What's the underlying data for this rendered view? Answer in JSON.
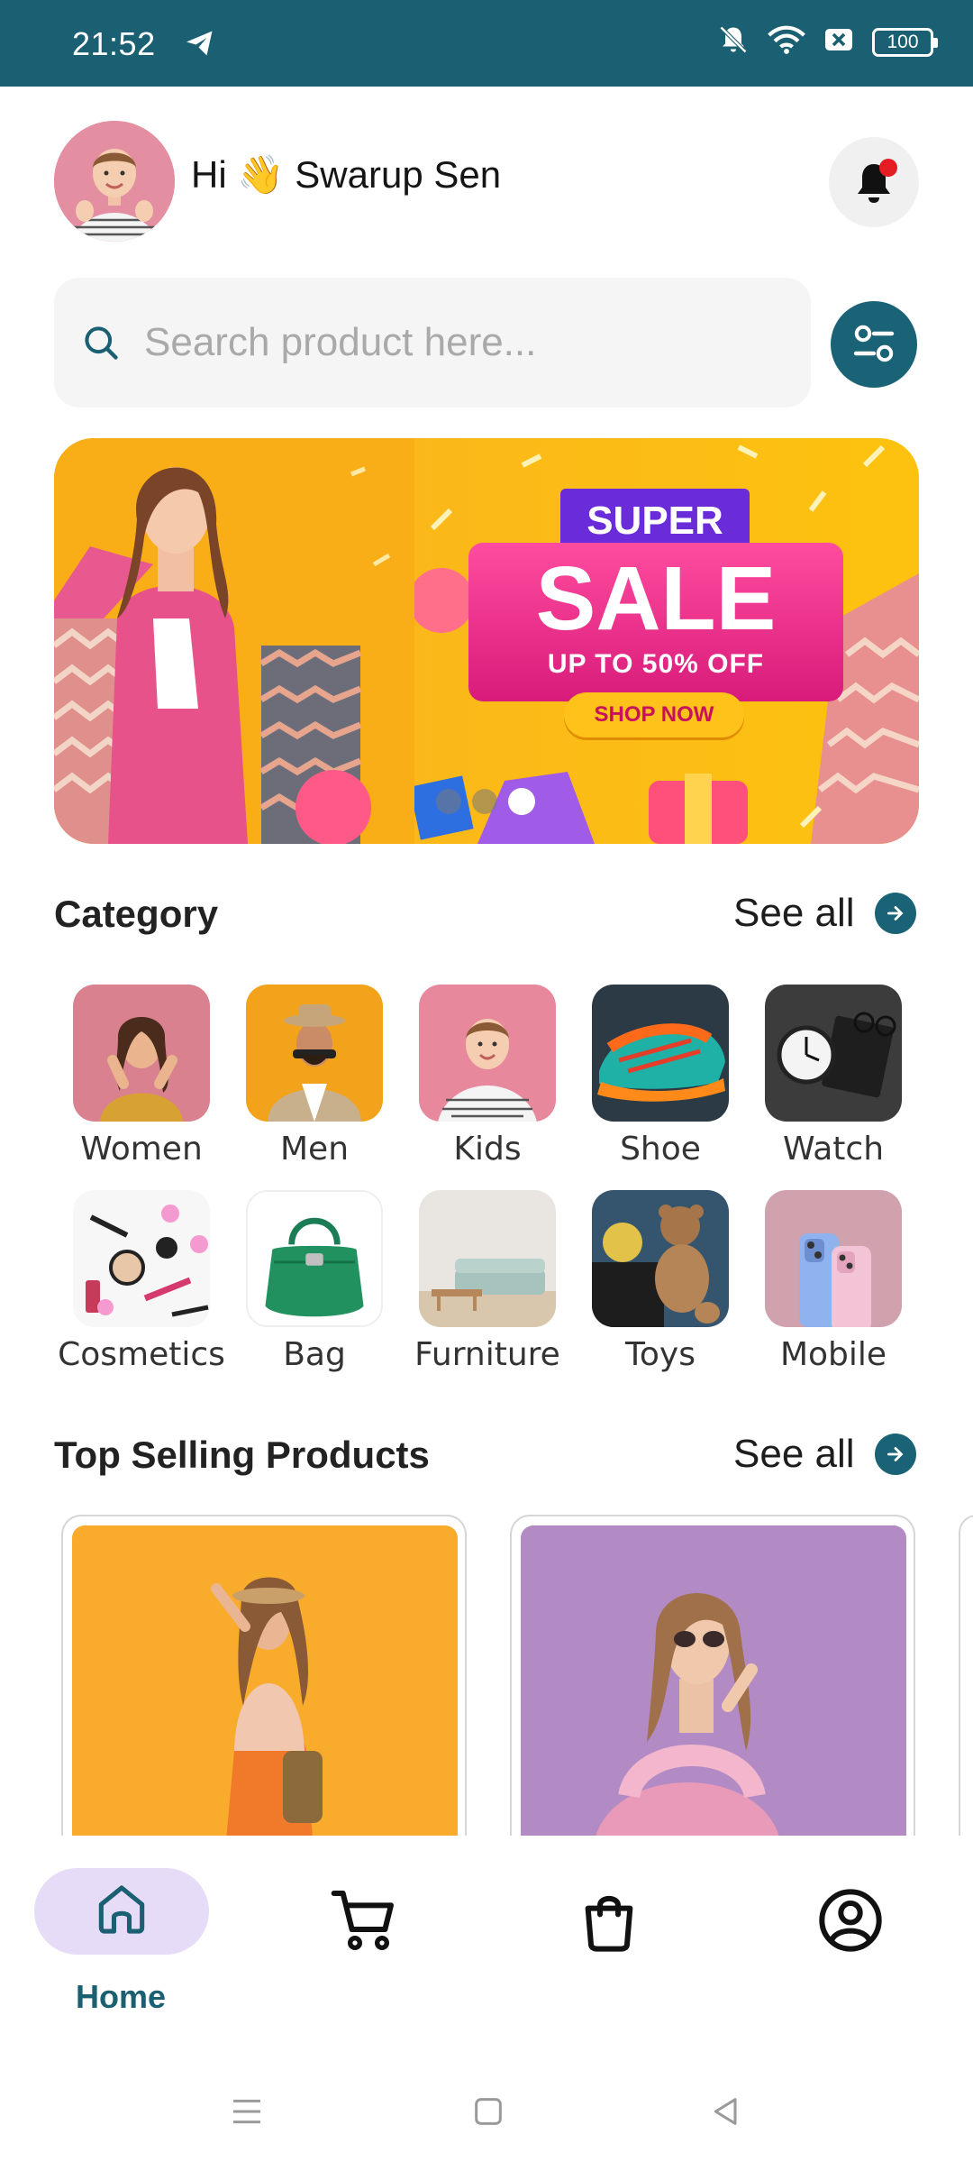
{
  "status_bar": {
    "time": "21:52",
    "battery": "100"
  },
  "header": {
    "greeting": "Hi 👋 Swarup Sen"
  },
  "search": {
    "placeholder": "Search product here..."
  },
  "banner": {
    "super_text": "SUPER",
    "sale_text": "SALE",
    "offer_text": "UP TO 50% OFF",
    "cta_text": "SHOP NOW",
    "slide_count": 3,
    "active_slide": 3
  },
  "category_section": {
    "title": "Category",
    "see_all": "See all",
    "items": [
      {
        "label": "Women"
      },
      {
        "label": "Men"
      },
      {
        "label": "Kids"
      },
      {
        "label": "Shoe"
      },
      {
        "label": "Watch"
      },
      {
        "label": "Cosmetics"
      },
      {
        "label": "Bag"
      },
      {
        "label": "Furniture"
      },
      {
        "label": "Toys"
      },
      {
        "label": "Mobile"
      }
    ]
  },
  "top_selling": {
    "title": "Top Selling Products",
    "see_all": "See all"
  },
  "bottom_nav": {
    "items": [
      {
        "label": "Home",
        "icon": "home-icon",
        "active": true
      },
      {
        "label": "",
        "icon": "cart-icon",
        "active": false
      },
      {
        "label": "",
        "icon": "shopping-bag-icon",
        "active": false
      },
      {
        "label": "",
        "icon": "profile-icon",
        "active": false
      }
    ]
  },
  "colors": {
    "primary": "#1a6377",
    "status_bar": "#1a5f72",
    "nav_active_bg": "#e6dcf7",
    "banner_yellow": "#fdc20f",
    "sale_pink": "#e0207f",
    "super_purple": "#6a2bd9"
  }
}
